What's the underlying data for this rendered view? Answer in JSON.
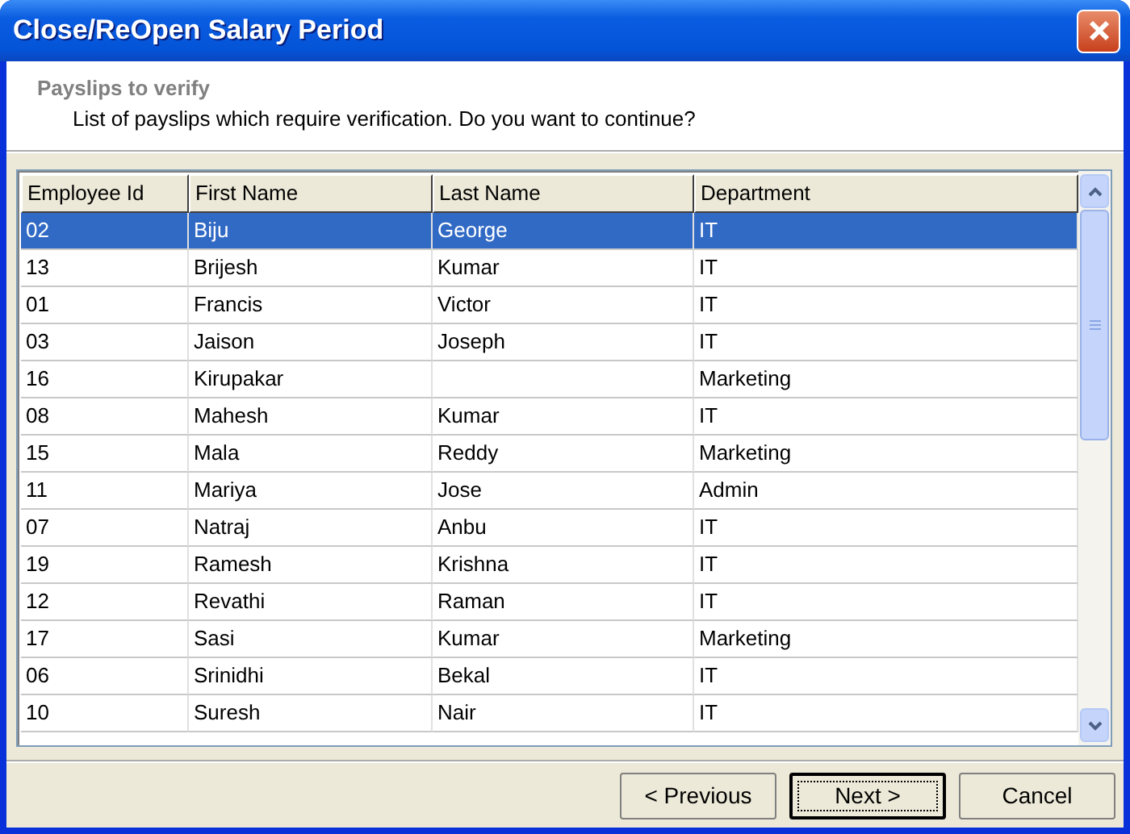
{
  "window": {
    "title": "Close/ReOpen Salary Period"
  },
  "header": {
    "title": "Payslips to verify",
    "subtitle": "List of payslips which require verification. Do you want to continue?"
  },
  "table": {
    "columns": [
      "Employee Id",
      "First Name",
      "Last Name",
      "Department"
    ],
    "rows": [
      {
        "cells": [
          "02",
          "Biju",
          "George",
          "IT"
        ],
        "selected": true
      },
      {
        "cells": [
          "13",
          "Brijesh",
          "Kumar",
          "IT"
        ],
        "selected": false
      },
      {
        "cells": [
          "01",
          "Francis",
          "Victor",
          "IT"
        ],
        "selected": false
      },
      {
        "cells": [
          "03",
          "Jaison",
          "Joseph",
          "IT"
        ],
        "selected": false
      },
      {
        "cells": [
          "16",
          "Kirupakar",
          "",
          "Marketing"
        ],
        "selected": false
      },
      {
        "cells": [
          "08",
          "Mahesh",
          "Kumar",
          "IT"
        ],
        "selected": false
      },
      {
        "cells": [
          "15",
          "Mala",
          "Reddy",
          "Marketing"
        ],
        "selected": false
      },
      {
        "cells": [
          "11",
          "Mariya",
          "Jose",
          "Admin"
        ],
        "selected": false
      },
      {
        "cells": [
          "07",
          "Natraj",
          "Anbu",
          "IT"
        ],
        "selected": false
      },
      {
        "cells": [
          "19",
          "Ramesh",
          "Krishna",
          "IT"
        ],
        "selected": false
      },
      {
        "cells": [
          "12",
          "Revathi",
          "Raman",
          "IT"
        ],
        "selected": false
      },
      {
        "cells": [
          "17",
          "Sasi",
          "Kumar",
          "Marketing"
        ],
        "selected": false
      },
      {
        "cells": [
          "06",
          "Srinidhi",
          "Bekal",
          "IT"
        ],
        "selected": false
      },
      {
        "cells": [
          "10",
          "Suresh",
          "Nair",
          "IT"
        ],
        "selected": false
      }
    ]
  },
  "buttons": [
    {
      "label": "< Previous",
      "default": false
    },
    {
      "label": "Next >",
      "default": true
    },
    {
      "label": "Cancel",
      "default": false
    }
  ]
}
